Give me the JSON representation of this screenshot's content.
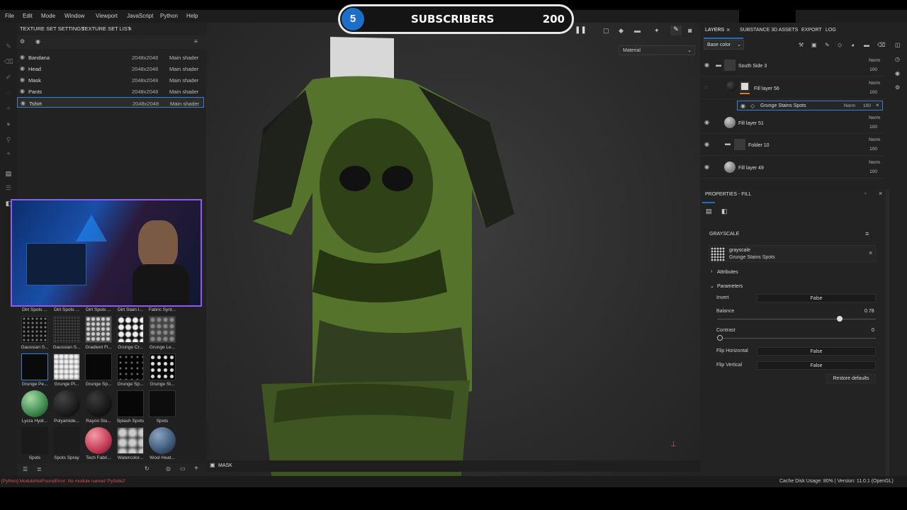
{
  "menu": [
    "File",
    "Edit",
    "Mode",
    "Window",
    "Viewport",
    "JavaScript",
    "Python",
    "Help"
  ],
  "banner": {
    "count_icon": "5",
    "label": "SUBSCRIBERS",
    "value": "200"
  },
  "texture_panel": {
    "tabs": [
      "TEXTURE SET SETTINGS",
      "TEXTURE SET LIST"
    ],
    "rows": [
      {
        "name": "Bandana",
        "res": "2048x2048",
        "shader": "Main shader"
      },
      {
        "name": "Head",
        "res": "2048x2048",
        "shader": "Main shader"
      },
      {
        "name": "Mask",
        "res": "2048x2048",
        "shader": "Main shader"
      },
      {
        "name": "Pants",
        "res": "2048x2048",
        "shader": "Main shader"
      },
      {
        "name": "Tshirt",
        "res": "2048x2048",
        "shader": "Main shader"
      }
    ]
  },
  "shelf": {
    "top_labels": [
      "Dirt Spots ...",
      "Dirt Spots ...",
      "Dirt Spots ...",
      "Dirt Stain I...",
      "Fabric Synt..."
    ],
    "row1": [
      "Gaussian S...",
      "Gaussian S...",
      "Gradient Fl...",
      "Grunge Cr...",
      "Grunge Le..."
    ],
    "row2": [
      "Grunge Pe...",
      "Grunge Pl...",
      "Grunge Sp...",
      "Grunge Sp...",
      "Grunge St..."
    ],
    "row3": [
      "Lycra Hydr...",
      "Polyamide...",
      "Rayon Slu...",
      "Splash Spots",
      "Spots"
    ],
    "row4": [
      "Spots",
      "Spots Spray",
      "Tech Fabri...",
      "Watercolor...",
      "Wool Heat..."
    ]
  },
  "viewport": {
    "material_dropdown": "Material",
    "mask_label": "MASK"
  },
  "layers_panel": {
    "tabs": [
      "LAYERS",
      "SUBSTANCE 3D ASSETS",
      "EXPORT",
      "LOG"
    ],
    "channel": "Base color",
    "layers": [
      {
        "name": "South Side 3",
        "blend": "Norm",
        "opacity": "100"
      },
      {
        "name": "Fill layer 56",
        "blend": "Norm",
        "opacity": "100"
      },
      {
        "name": "Grunge Stains Spots",
        "blend": "Norm",
        "opacity": "100"
      },
      {
        "name": "Fill layer 51",
        "blend": "Norm",
        "opacity": "100"
      },
      {
        "name": "Folder 10",
        "blend": "Norm",
        "opacity": "100"
      },
      {
        "name": "Fill layer 49",
        "blend": "Norm",
        "opacity": "100"
      }
    ]
  },
  "properties": {
    "title": "PROPERTIES - FILL",
    "section": "GRAYSCALE",
    "resource_type": "grayscale",
    "resource_name": "Grunge Stains Spots",
    "attributes": "Attributes",
    "parameters": "Parameters",
    "invert_label": "Invert",
    "invert_value": "False",
    "balance_label": "Balance",
    "balance_value": "0.78",
    "contrast_label": "Contrast",
    "contrast_value": "0",
    "fliph_label": "Flip Horizontal",
    "fliph_value": "False",
    "flipv_label": "Flip Vertical",
    "flipv_value": "False",
    "restore": "Restore defaults"
  },
  "status": {
    "error": "[Python] ModuleNotFoundError: No module named 'PySide2'",
    "info": "Cache Disk Usage:   80% | Version: 11.0.1 (OpenGL)"
  },
  "colors": {
    "accent": "#1b6fc9",
    "error": "#d9534f",
    "shirt_green": "#55732a"
  }
}
